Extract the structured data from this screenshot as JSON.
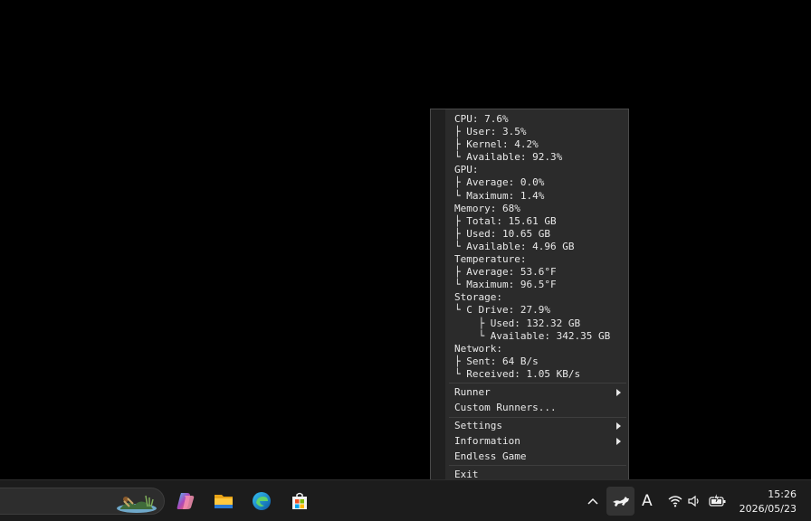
{
  "stats": {
    "lines": [
      "CPU: 7.6%",
      "├ User: 3.5%",
      "├ Kernel: 4.2%",
      "└ Available: 92.3%",
      "GPU:",
      "├ Average: 0.0%",
      "└ Maximum: 1.4%",
      "Memory: 68%",
      "├ Total: 15.61 GB",
      "├ Used: 10.65 GB",
      "└ Available: 4.96 GB",
      "Temperature:",
      "├ Average: 53.6°F",
      "└ Maximum: 96.5°F",
      "Storage:",
      "└ C Drive: 27.9%",
      "    ├ Used: 132.32 GB",
      "    └ Available: 342.35 GB",
      "Network:",
      "├ Sent: 64 B/s",
      "└ Received: 1.05 KB/s"
    ]
  },
  "menu": {
    "runner": "Runner",
    "custom_runners": "Custom Runners...",
    "settings": "Settings",
    "information": "Information",
    "endless_game": "Endless Game",
    "exit": "Exit"
  },
  "taskbar": {
    "apps": [
      "copilot-icon",
      "file-explorer-icon",
      "edge-icon",
      "microsoft-store-icon"
    ],
    "tray": {
      "ime": "A"
    },
    "clock": {
      "time": "15:26",
      "date": "2026/05/23"
    }
  }
}
